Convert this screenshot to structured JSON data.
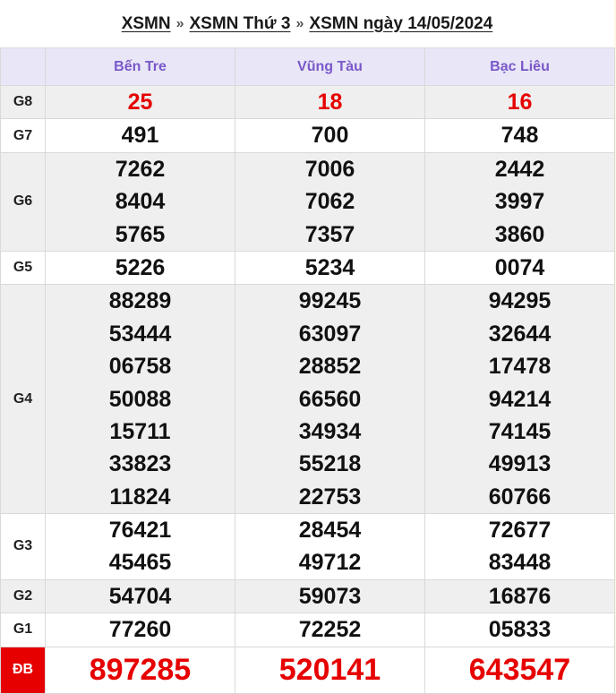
{
  "breadcrumb": {
    "link1": "XSMN",
    "link2": "XSMN Thứ 3",
    "link3": "XSMN ngày 14/05/2024",
    "separator": "»"
  },
  "provinces": [
    "Bến Tre",
    "Vũng Tàu",
    "Bạc Liêu"
  ],
  "prizes": {
    "G8": {
      "label": "G8",
      "values": [
        [
          "25"
        ],
        [
          "18"
        ],
        [
          "16"
        ]
      ]
    },
    "G7": {
      "label": "G7",
      "values": [
        [
          "491"
        ],
        [
          "700"
        ],
        [
          "748"
        ]
      ]
    },
    "G6": {
      "label": "G6",
      "values": [
        [
          "7262",
          "8404",
          "5765"
        ],
        [
          "7006",
          "7062",
          "7357"
        ],
        [
          "2442",
          "3997",
          "3860"
        ]
      ]
    },
    "G5": {
      "label": "G5",
      "values": [
        [
          "5226"
        ],
        [
          "5234"
        ],
        [
          "0074"
        ]
      ]
    },
    "G4": {
      "label": "G4",
      "values": [
        [
          "88289",
          "53444",
          "06758",
          "50088",
          "15711",
          "33823",
          "11824"
        ],
        [
          "99245",
          "63097",
          "28852",
          "66560",
          "34934",
          "55218",
          "22753"
        ],
        [
          "94295",
          "32644",
          "17478",
          "94214",
          "74145",
          "49913",
          "60766"
        ]
      ]
    },
    "G3": {
      "label": "G3",
      "values": [
        [
          "76421",
          "45465"
        ],
        [
          "28454",
          "49712"
        ],
        [
          "72677",
          "83448"
        ]
      ]
    },
    "G2": {
      "label": "G2",
      "values": [
        [
          "54704"
        ],
        [
          "59073"
        ],
        [
          "16876"
        ]
      ]
    },
    "G1": {
      "label": "G1",
      "values": [
        [
          "77260"
        ],
        [
          "72252"
        ],
        [
          "05833"
        ]
      ]
    },
    "DB": {
      "label": "ĐB",
      "values": [
        [
          "897285"
        ],
        [
          "520141"
        ],
        [
          "643547"
        ]
      ]
    }
  },
  "colors": {
    "accent_red": "#e60000",
    "header_purple": "#7a58c9"
  }
}
